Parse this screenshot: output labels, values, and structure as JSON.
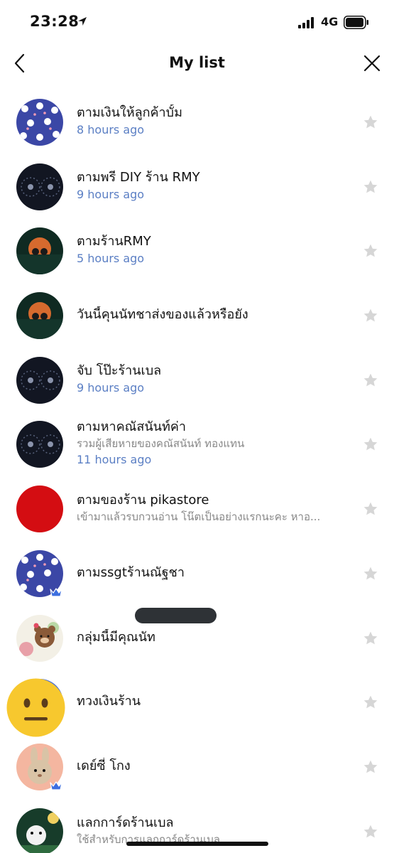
{
  "status_bar": {
    "time": "23:28",
    "network": "4G"
  },
  "header": {
    "title": "My list"
  },
  "colors": {
    "time_text": "#5b7fc4",
    "star": "#d6d6d6",
    "subtitle": "#888888"
  },
  "items": [
    {
      "title": "ตามเงินให้ลูกค้าบั้ม",
      "subtitle": "",
      "time": "8 hours ago",
      "avatar": "bunny-pattern-avatar",
      "badge": false
    },
    {
      "title": "ตามพรี DIY ร้าน RMY",
      "subtitle": "",
      "time": "9 hours ago",
      "avatar": "dark-sparkle-avatar",
      "badge": false
    },
    {
      "title": "ตามร้านRMY",
      "subtitle": "",
      "time": "5 hours ago",
      "avatar": "sunset-bears-avatar",
      "badge": false
    },
    {
      "title": "วันนี้คุนนัทชาส่งของแล้วหรือยัง",
      "subtitle": "",
      "time": "",
      "avatar": "sunset-bears-avatar",
      "badge": false
    },
    {
      "title": "จับ โป๊ะร้านเบล",
      "subtitle": "",
      "time": "9 hours ago",
      "avatar": "dark-sparkle-avatar",
      "badge": false
    },
    {
      "title": "ตามหาคณัสนันท์ค่า",
      "subtitle": "รวมผู้เสียหายของคณัสนันท์ ทองแทน",
      "time": "11 hours ago",
      "avatar": "dark-sparkle-avatar",
      "badge": false
    },
    {
      "title": "ตามของร้าน pikastore",
      "subtitle": "เข้ามาแล้วรบกวนอ่าน โน๊ตเป็นอย่างแรกนะคะ หาอ...",
      "time": "",
      "avatar": "red-avatar",
      "badge": false
    },
    {
      "title": "ตามssgtร้านณัฐชา",
      "subtitle": "",
      "time": "",
      "avatar": "bunny-pattern-avatar",
      "badge": true
    },
    {
      "title": "กลุ่มนี้มีคุณนัท",
      "subtitle": "",
      "time": "",
      "avatar": "brown-bear-avatar",
      "badge": false
    },
    {
      "title": "ทวงเงินร้าน",
      "subtitle": "",
      "time": "",
      "avatar": "hidden-avatar",
      "badge": false
    },
    {
      "title": "เดย์ซี่ โกง",
      "subtitle": "",
      "time": "",
      "avatar": "rabbit-avatar",
      "badge": true
    },
    {
      "title": "แลกการ์ดร้านเบล",
      "subtitle": "ใช้สำหรับการแลกการ์ดร้านเบล",
      "time": "",
      "avatar": "green-bear-avatar",
      "badge": false
    }
  ]
}
